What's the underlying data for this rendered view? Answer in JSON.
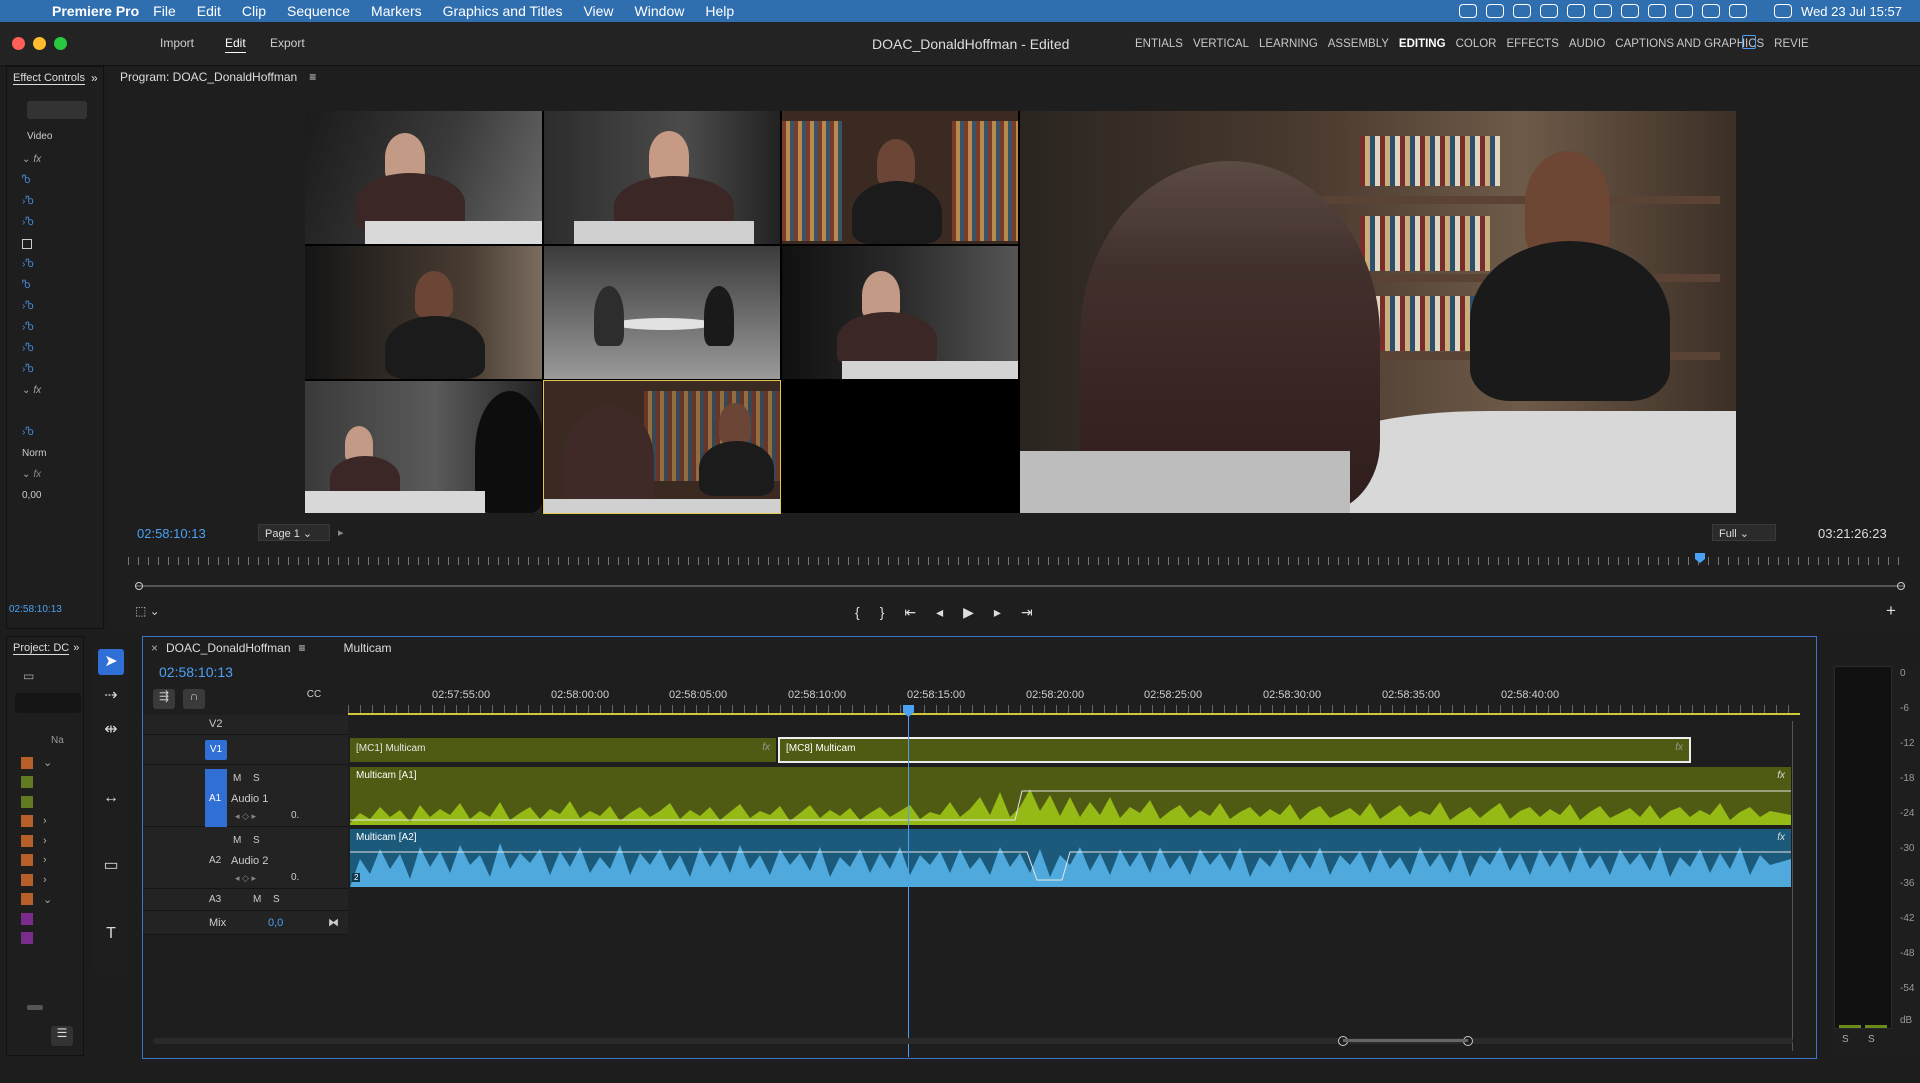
{
  "menubar": {
    "app_name": "Premiere Pro",
    "items": [
      "File",
      "Edit",
      "Clip",
      "Sequence",
      "Markers",
      "Graphics and Titles",
      "View",
      "Window",
      "Help"
    ],
    "clock": "Wed 23 Jul  15:57"
  },
  "titlebar": {
    "nav": {
      "import": "Import",
      "edit": "Edit",
      "export": "Export"
    },
    "doc_title": "DOAC_DonaldHoffman - Edited",
    "workspaces": [
      "ENTIALS",
      "VERTICAL",
      "LEARNING",
      "ASSEMBLY",
      "EDITING",
      "COLOR",
      "EFFECTS",
      "AUDIO",
      "CAPTIONS AND GRAPHICS",
      "REVIE"
    ],
    "active_workspace": "EDITING"
  },
  "effect_controls": {
    "tab": "Effect Controls",
    "section": "Video",
    "blend_mode": "Norm",
    "timecode": "02:58:10:13",
    "value": "0,00"
  },
  "program_monitor": {
    "title": "Program: DOAC_DonaldHoffman",
    "current_time": "02:58:10:13",
    "page": "Page 1",
    "resolution": "Full",
    "duration": "03:21:26:23"
  },
  "project": {
    "tab": "Project: DC",
    "column": "Na",
    "swatches": [
      "#b65f2a",
      "#617a22",
      "#617a22",
      "#b65f2a",
      "#b65f2a",
      "#b65f2a",
      "#b65f2a",
      "#b65f2a",
      "#7a2c8c",
      "#7a2c8c"
    ]
  },
  "timeline": {
    "sequence_tab": "DOAC_DonaldHoffman",
    "multicam_tab": "Multicam",
    "timecode": "02:58:10:13",
    "ruler": [
      "02:57:55:00",
      "02:58:00:00",
      "02:58:05:00",
      "02:58:10:00",
      "02:58:15:00",
      "02:58:20:00",
      "02:58:25:00",
      "02:58:30:00",
      "02:58:35:00",
      "02:58:40:00"
    ],
    "tracks": {
      "v2": "V2",
      "v1": "V1",
      "a1": "A1",
      "a1_name": "Audio 1",
      "a2": "A2",
      "a2_name": "Audio 2",
      "a3": "A3",
      "mix": "Mix",
      "mix_value": "0,0"
    },
    "clips": {
      "v1_clip1": "[MC1] Multicam",
      "v1_clip2": "[MC8] Multicam",
      "a1_clip": "Multicam [A1]",
      "a2_clip": "Multicam [A2]"
    }
  },
  "audio_meter": {
    "scale": [
      "0",
      "-6",
      "-12",
      "-18",
      "-24",
      "-30",
      "-36",
      "-42",
      "-48",
      "-54",
      "dB"
    ],
    "solo": [
      "S",
      "S"
    ]
  },
  "colors": {
    "accent": "#4ba1f5",
    "video_clip": "#4f5a12",
    "audio1": "#95b915",
    "audio2": "#4fa9dc"
  }
}
